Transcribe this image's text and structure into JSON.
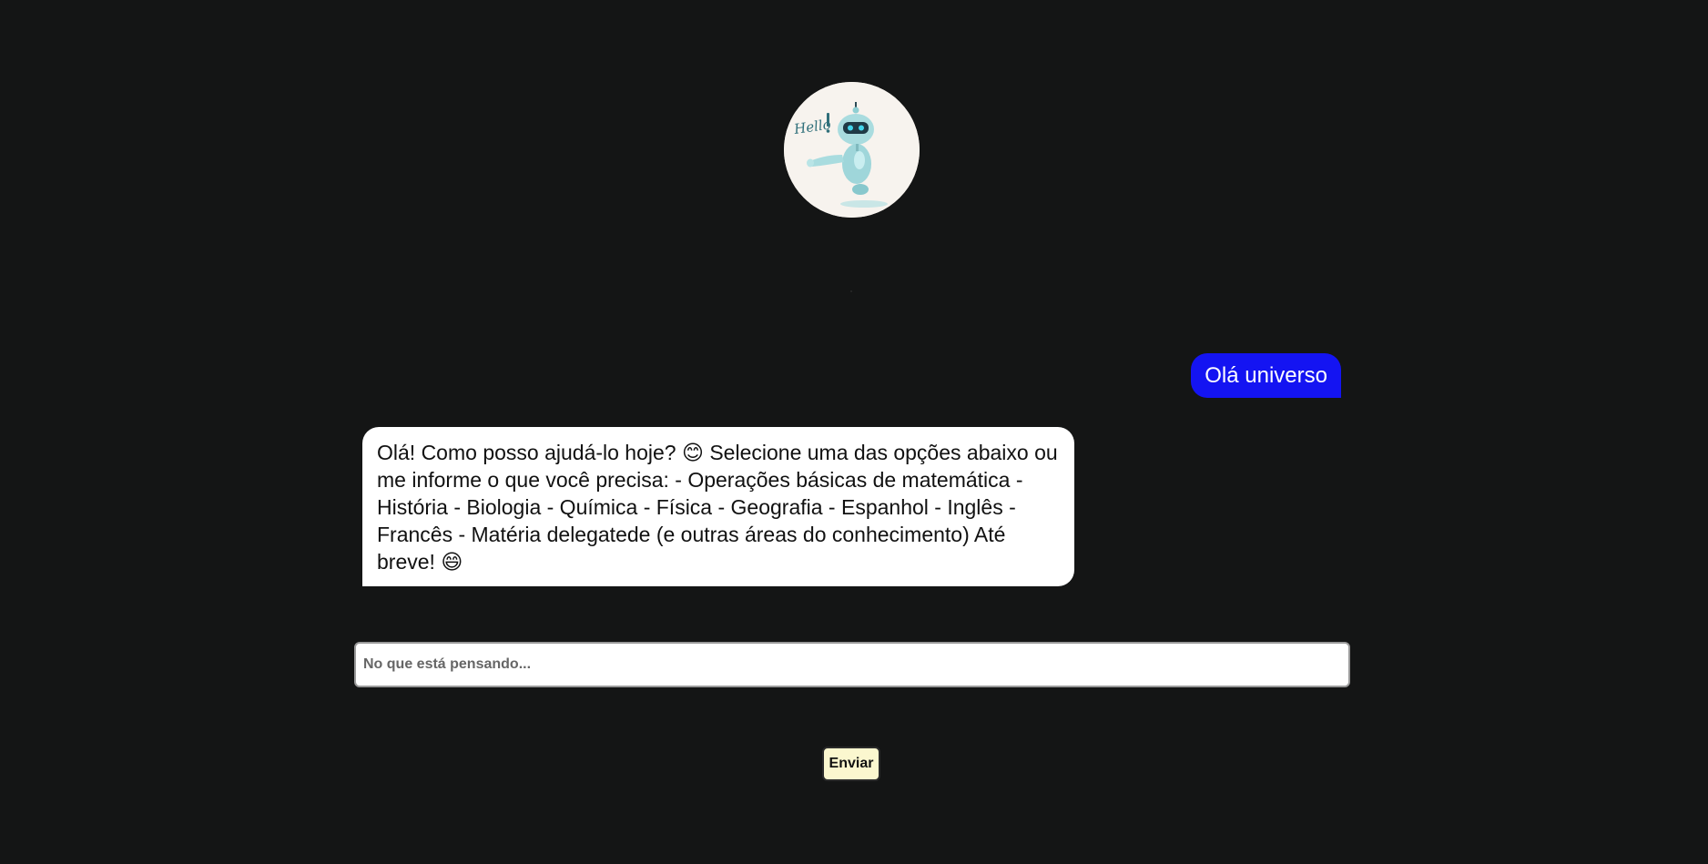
{
  "avatar": {
    "icon": "robot-hello-icon",
    "caption": "Hello!"
  },
  "messages": [
    {
      "role": "user",
      "text": "Olá universo",
      "color": "#1414f2"
    },
    {
      "role": "bot",
      "text": "Olá! Como posso ajudá-lo hoje? 😊 Selecione uma das opções abaixo ou me informe o que você precisa: - Operações básicas de matemática - História - Biologia - Química - Física - Geografia - Espanhol - Inglês - Francês - Matéria delegatede (e outras áreas do conhecimento) Até breve! 😄",
      "color": "#ffffff"
    }
  ],
  "composer": {
    "placeholder": "No que está pensando...",
    "value": ""
  },
  "send_button": {
    "label": "Enviar",
    "color": "#fbf7cf"
  },
  "colors": {
    "background": "#141515",
    "user_bubble": "#1414f2",
    "bot_bubble": "#ffffff"
  }
}
